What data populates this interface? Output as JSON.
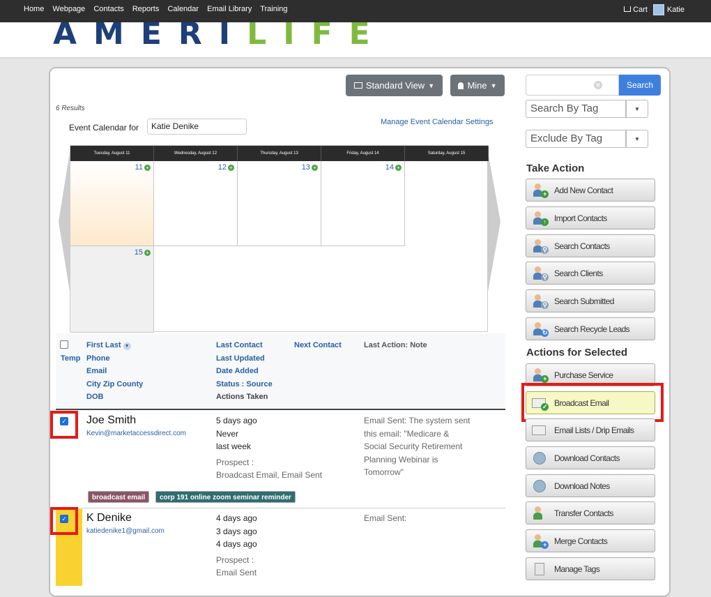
{
  "topnav": {
    "links": [
      "Home",
      "Webpage",
      "Contacts",
      "Reports",
      "Calendar",
      "Email Library",
      "Training"
    ],
    "cart_label": "Cart",
    "user_name": "Katie"
  },
  "brand": {
    "logo_part1": "AMERI",
    "logo_part2": "LIFE",
    "colors": {
      "primary": "#1d3f7a",
      "accent": "#7fba3e"
    }
  },
  "toolbar": {
    "view_label": "Standard View",
    "mine_label": "Mine"
  },
  "results_text": "6 Results",
  "event_calendar": {
    "label": "Event Calendar for",
    "selected": "Katie Denike",
    "manage_link": "Manage Event Calendar Settings",
    "days": [
      "Tuesday, August 11",
      "Wednesday, August 12",
      "Thursday, August 13",
      "Friday, August 14",
      "Saturday, August 15"
    ],
    "cells": [
      "11",
      "12",
      "13",
      "14",
      "15"
    ]
  },
  "table_headers": {
    "temp": "Temp",
    "col1": [
      "First Last",
      "Phone",
      "Email",
      "City Zip County",
      "DOB"
    ],
    "col2": [
      "Last Contact",
      "Last Updated",
      "Date Added",
      "Status : Source",
      "Actions Taken"
    ],
    "next_contact": "Next Contact",
    "last_action": "Last Action: Note"
  },
  "contacts": [
    {
      "name": "Joe Smith",
      "email": "Kevin@marketaccessdirect.com",
      "last_contact": "5 days ago",
      "last_updated": "Never",
      "date_added": "last week",
      "status": "Prospect :",
      "actions": "Broadcast Email, Email Sent",
      "note": [
        "Email Sent: The system sent",
        "this email: \"Medicare &",
        "Social Security Retirement",
        "Planning Webinar is",
        "Tomorrow\""
      ],
      "tags": [
        "broadcast email",
        "corp 191 online zoom seminar reminder"
      ]
    },
    {
      "name": "K Denike",
      "email": "katiedenike1@gmail.com",
      "last_contact": "4 days ago",
      "last_updated": "3 days ago",
      "date_added": "4 days ago",
      "status": "Prospect :",
      "actions": "Email Sent",
      "note": [
        "Email Sent:"
      ]
    }
  ],
  "sidebar": {
    "search_button": "Search",
    "search_by_tag": "Search By Tag",
    "exclude_by_tag": "Exclude By Tag",
    "take_action_title": "Take Action",
    "take_action": [
      {
        "label": "Add New Contact",
        "icon": "add-contact-icon"
      },
      {
        "label": "Import Contacts",
        "icon": "import-contacts-icon"
      },
      {
        "label": "Search Contacts",
        "icon": "search-contacts-icon"
      },
      {
        "label": "Search Clients",
        "icon": "search-clients-icon"
      },
      {
        "label": "Search Submitted",
        "icon": "search-submitted-icon"
      },
      {
        "label": "Search Recycle Leads",
        "icon": "recycle-leads-icon"
      }
    ],
    "selected_title": "Actions for Selected",
    "selected_actions": [
      {
        "label": "Purchase Service",
        "icon": "purchase-service-icon"
      },
      {
        "label": "Broadcast Email",
        "icon": "broadcast-email-icon"
      },
      {
        "label": "Email Lists / Drip Emails",
        "icon": "email-lists-icon"
      },
      {
        "label": "Download Contacts",
        "icon": "download-contacts-icon"
      },
      {
        "label": "Download Notes",
        "icon": "download-notes-icon"
      },
      {
        "label": "Transfer Contacts",
        "icon": "transfer-contacts-icon"
      },
      {
        "label": "Merge Contacts",
        "icon": "merge-contacts-icon"
      },
      {
        "label": "Manage Tags",
        "icon": "manage-tags-icon"
      }
    ]
  }
}
